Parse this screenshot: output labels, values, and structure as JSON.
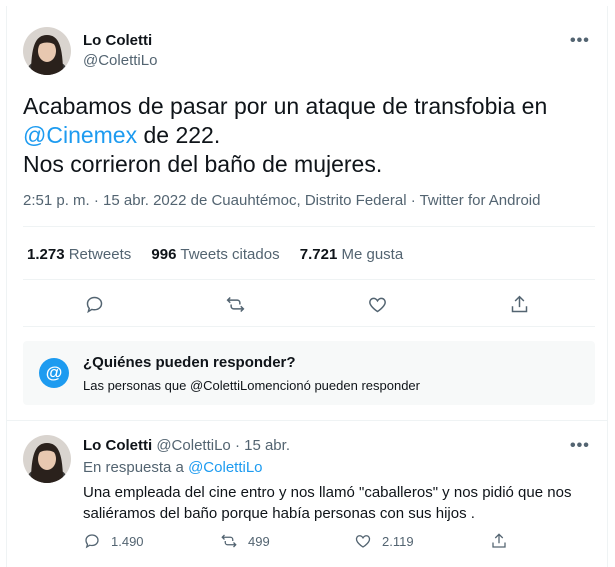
{
  "tweet": {
    "author_name": "Lo Coletti",
    "author_handle": "@ColettiLo",
    "more_label": "•••",
    "text_line1": "Acabamos de pasar por un ataque de transfobia en",
    "text_mention": "@Cinemex",
    "text_line2_rest": " de 222.",
    "text_line3": "Nos corrieron del baño de mujeres.",
    "meta": "2:51 p. m. · 15 abr. 2022 de Cuauhtémoc, Distrito Federal · Twitter for Android",
    "stats": {
      "retweets_count": "1.273",
      "retweets_label": "Retweets",
      "quotes_count": "996",
      "quotes_label": "Tweets citados",
      "likes_count": "7.721",
      "likes_label": "Me gusta"
    },
    "actions": [
      "reply-icon",
      "retweet-icon",
      "like-icon",
      "share-icon"
    ]
  },
  "who_can_reply": {
    "icon": "@",
    "title": "¿Quiénes pueden responder?",
    "subtitle": "Las personas que @ColettiLomencionó pueden responder"
  },
  "reply": {
    "author_name": "Lo Coletti",
    "author_handle": "@ColettiLo",
    "dot": "·",
    "date": "15 abr.",
    "more_label": "•••",
    "in_reply_prefix": "En respuesta a ",
    "in_reply_mention": "@ColettiLo",
    "text": "Una empleada del cine entro y nos llamó \"caballeros\" y nos pidió que nos saliéramos del baño porque había personas con sus hijos .",
    "replies_count": "1.490",
    "retweets_count": "499",
    "likes_count": "2.119"
  },
  "colors": {
    "accent": "#1d9bf0",
    "text": "#0f1419",
    "secondary": "#536471",
    "border": "#eff3f4"
  }
}
